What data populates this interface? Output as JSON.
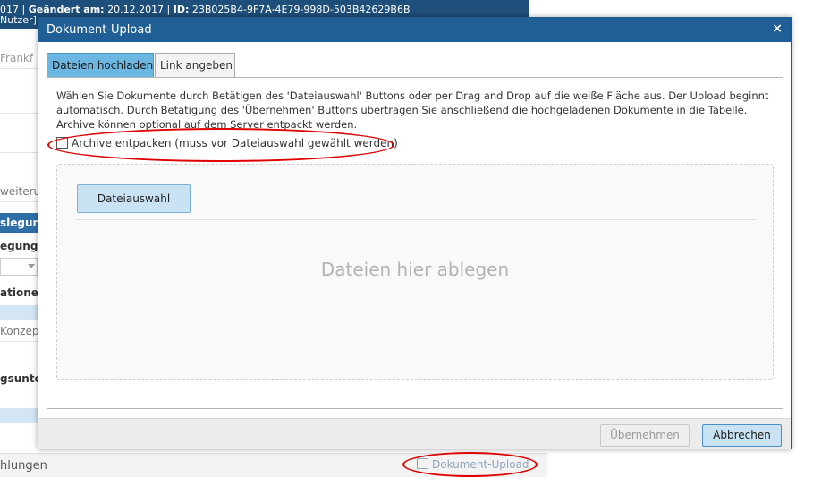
{
  "background": {
    "header_line1_date": "017",
    "header_changed_label": "Geändert am:",
    "header_changed_value": "20.12.2017",
    "header_id_label": "ID:",
    "header_id_value": "23B025B4-9F7A-4E79-998D-503B42629B6B",
    "header_line2": "Nutzer]",
    "rows": [
      "Frankf",
      "weiteru",
      "slegun",
      "egung v",
      "ationer",
      "Konzept",
      "gsunter",
      "hlungen"
    ],
    "upload_link": "Dokument-Upload"
  },
  "dialog": {
    "title": "Dokument-Upload",
    "close": "×",
    "tabs": [
      {
        "label": "Dateien hochladen",
        "active": true
      },
      {
        "label": "Link angeben",
        "active": false
      }
    ],
    "description": "Wählen Sie Dokumente durch Betätigen des 'Dateiauswahl' Buttons oder per Drag and Drop auf die weiße Fläche aus. Der Upload beginnt automatisch. Durch Betätigung des 'Übernehmen' Buttons übertragen Sie anschließend die hochgeladenen Dokumente in die Tabelle. Archive können optional auf dem Server entpackt werden.",
    "archive_checkbox": {
      "label": "Archive entpacken (muss vor Dateiauswahl gewählt werden)",
      "checked": false
    },
    "file_button": "Dateiauswahl",
    "dropzone_text": "Dateien hier ablegen",
    "apply_button": "Übernehmen",
    "cancel_button": "Abbrechen"
  },
  "colors": {
    "title_bar": "#1f5f96",
    "active_tab": "#6cb6e2",
    "button_blue": "#c9e3f4",
    "annotation": "#e00000"
  }
}
